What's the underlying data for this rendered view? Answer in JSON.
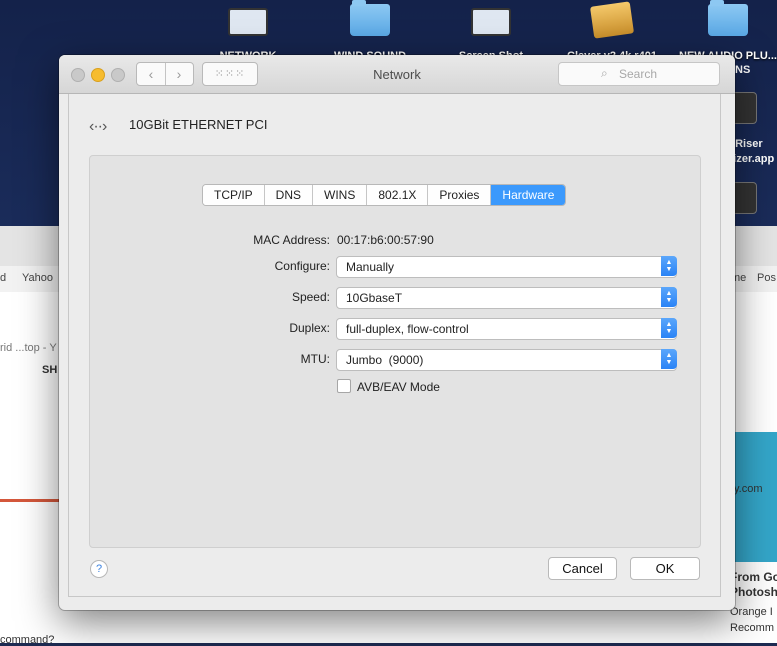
{
  "desktop": {
    "icons": [
      "NETWORK",
      "WIND SOUND",
      "Screen Shot",
      "Clever v2.4k r401",
      "NEW AUDIO PLU..."
    ],
    "side_labels": [
      "INS",
      "eRiser",
      "rizer.app"
    ]
  },
  "browser": {
    "bookmarks": [
      "d",
      "Yahoo",
      "me",
      "Pos"
    ],
    "text": {
      "crumb": "rid ...top - Y",
      "share": "SH",
      "domain": "y.com",
      "from": "From Go",
      "photos": "Photosh",
      "orange": "Orange I",
      "recomm": "Recomm",
      "command": "command?"
    }
  },
  "window": {
    "title": "Network",
    "search_placeholder": "Search",
    "interface_name": "10GBit ETHERNET PCI",
    "tabs": [
      "TCP/IP",
      "DNS",
      "WINS",
      "802.1X",
      "Proxies",
      "Hardware"
    ],
    "active_tab": "Hardware",
    "fields": {
      "mac_label": "MAC Address:",
      "mac_value": "00:17:b6:00:57:90",
      "configure_label": "Configure:",
      "configure_value": "Manually",
      "speed_label": "Speed:",
      "speed_value": "10GbaseT",
      "duplex_label": "Duplex:",
      "duplex_value": "full-duplex, flow-control",
      "mtu_label": "MTU:",
      "mtu_value": "Jumbo  (9000)"
    },
    "avb_label": "AVB/EAV Mode",
    "avb_checked": false,
    "help_label": "?",
    "cancel_label": "Cancel",
    "ok_label": "OK",
    "accent_color": "#3b99fc"
  }
}
